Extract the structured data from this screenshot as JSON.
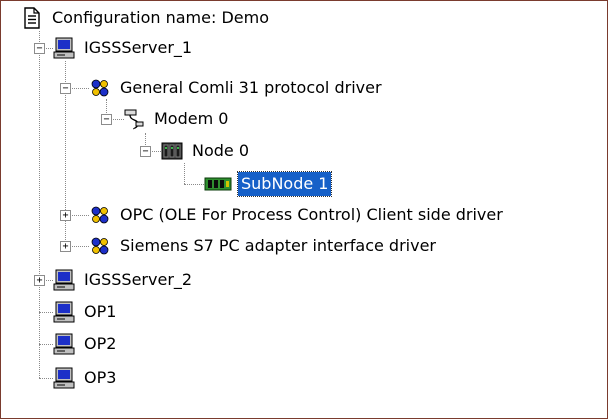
{
  "tree": {
    "root_label": "Configuration name: Demo",
    "server1": "IGSSServer_1",
    "comli_driver": "General Comli 31 protocol driver",
    "modem": "Modem 0",
    "node": "Node 0",
    "subnode": "SubNode 1",
    "opc_driver": "OPC (OLE For Process Control) Client side driver",
    "s7_driver": "Siemens S7 PC adapter interface driver",
    "server2": "IGSSServer_2",
    "op1": "OP1",
    "op2": "OP2",
    "op3": "OP3"
  },
  "glyphs": {
    "expanded": "−",
    "collapsed": "+"
  },
  "icons": {
    "root": "document-icon",
    "server": "computer-icon",
    "driver": "driver-icon",
    "modem": "modem-icon",
    "node": "rack-icon",
    "subnode": "board-icon"
  },
  "colors": {
    "selection": "#1660c8",
    "border": "#7a3b2e"
  }
}
